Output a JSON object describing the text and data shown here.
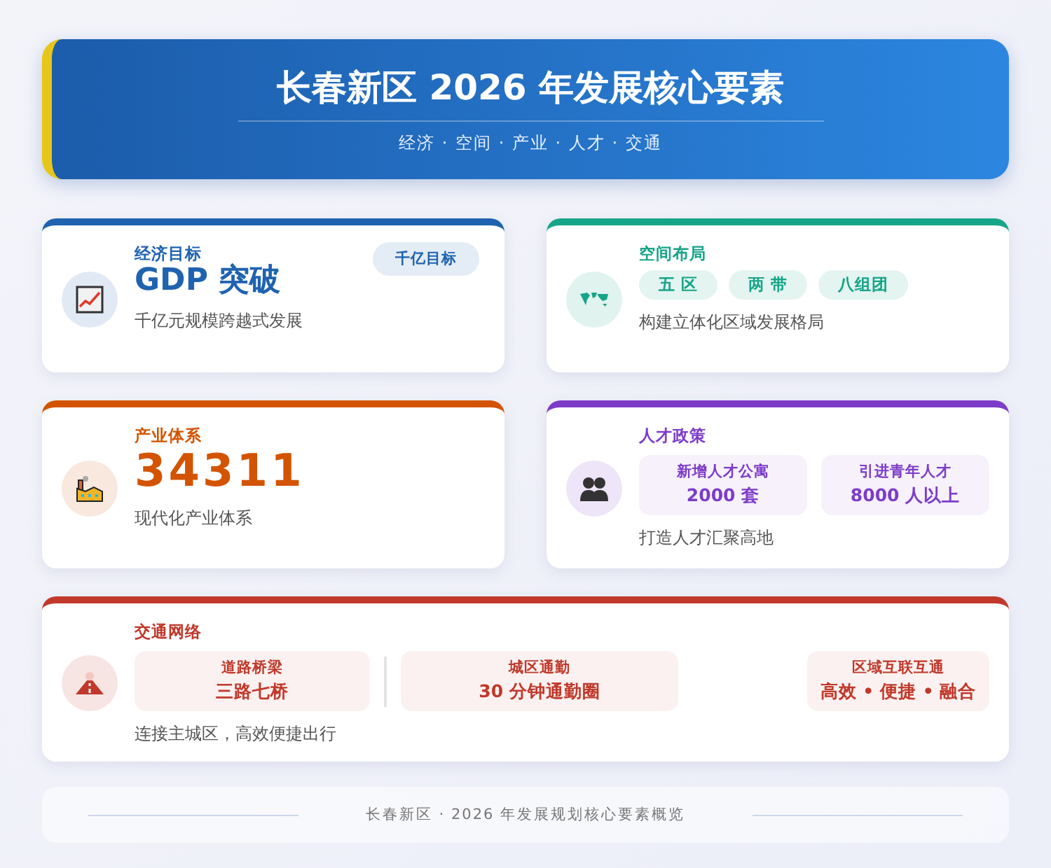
{
  "header": {
    "title": "长春新区 2026 年发展核心要素",
    "subtitle": "经济 · 空间 · 产业 · 人才 · 交通"
  },
  "cards": [
    {
      "kind": "headline",
      "color": "#1f63b0",
      "label": "经济目标",
      "headline": "GDP 突破",
      "badge": "千亿目标",
      "description": "千亿元规模跨越式发展"
    },
    {
      "kind": "tags",
      "color": "#17a589",
      "label": "空间布局",
      "tags": [
        "五 区",
        "两 带",
        "八组团"
      ],
      "description": "构建立体化区域发展格局"
    },
    {
      "kind": "headline",
      "color": "#d35400",
      "label": "产业体系",
      "headline": "34311",
      "description": "现代化产业体系"
    },
    {
      "kind": "boxes",
      "color": "#7d3cc8",
      "label": "人才政策",
      "boxes": [
        {
          "title": "新增人才公寓",
          "value": "2000 套"
        },
        {
          "title": "引进青年人才",
          "value": "8000 人以上"
        }
      ],
      "description": "打造人才汇聚高地"
    },
    {
      "kind": "transport",
      "color": "#c0392b",
      "label": "交通网络",
      "boxes": [
        {
          "title": "道路桥梁",
          "value": "三路七桥"
        },
        {
          "title": "城区通勤",
          "value": "30 分钟通勤圈"
        },
        {
          "title": "区域互联互通",
          "value": "高效 • 便捷 • 融合"
        }
      ],
      "description": "连接主城区，高效便捷出行"
    }
  ],
  "footer": "长春新区 · 2026 年发展规划核心要素概览"
}
